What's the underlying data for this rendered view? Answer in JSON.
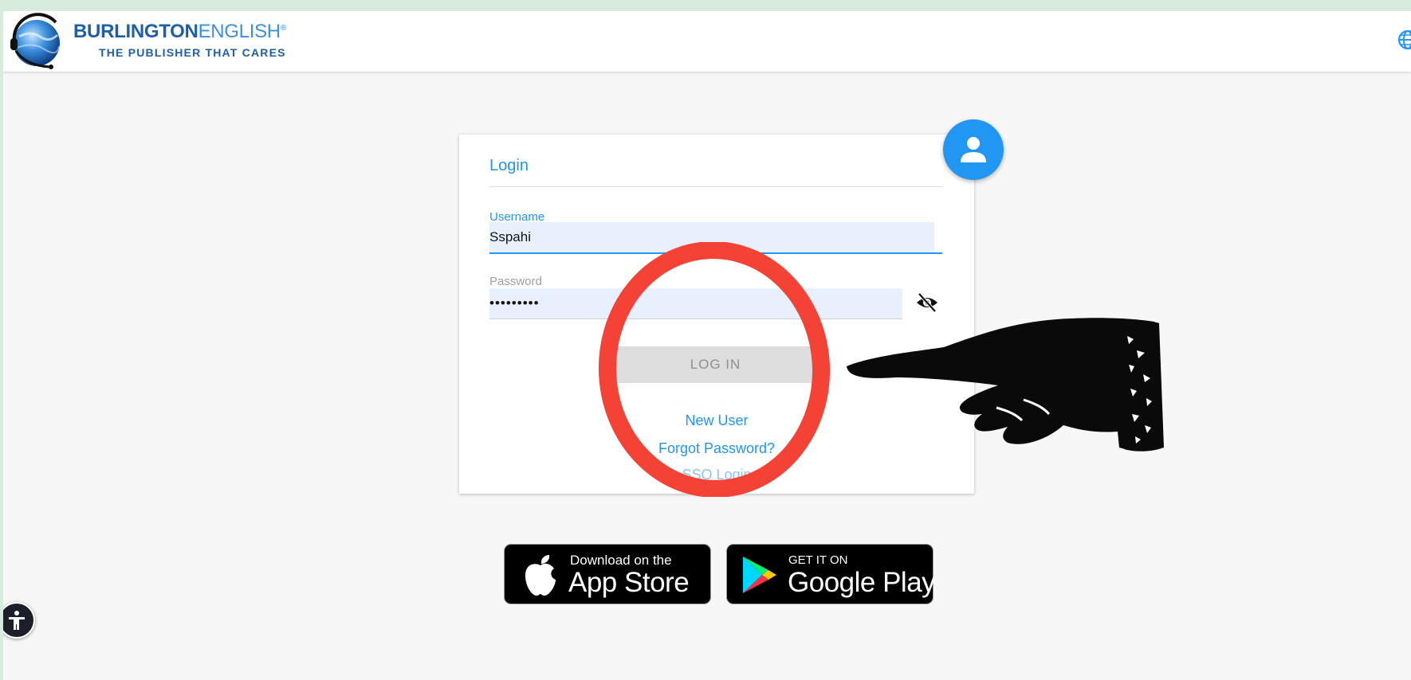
{
  "header": {
    "brand_bold": "BURLINGTON",
    "brand_light": "ENGLISH",
    "brand_reg": "®",
    "tagline": "THE PUBLISHER THAT CARES",
    "language_icon": "globe-icon"
  },
  "login": {
    "title": "Login",
    "username_label": "Username",
    "username_value": "Sspahi",
    "password_label": "Password",
    "password_value": "•••••••••",
    "toggle_icon": "eye-off-icon",
    "login_button": "LOG IN",
    "new_user_link": "New User",
    "forgot_link": "Forgot Password?",
    "sso_link": "SSO Login",
    "avatar_icon": "user-icon"
  },
  "stores": {
    "apple_small": "Download on the",
    "apple_big": "App Store",
    "google_small": "GET IT ON",
    "google_big": "Google Play"
  },
  "accessibility": {
    "icon": "accessibility-icon"
  },
  "annotations": {
    "circle": "red-circle-annotation",
    "hand": "pointing-hand-illustration"
  },
  "colors": {
    "accent": "#2196f3",
    "brand": "#1f5fa8",
    "input_bg": "#e8f0fe",
    "annotation_red": "#f44336"
  }
}
